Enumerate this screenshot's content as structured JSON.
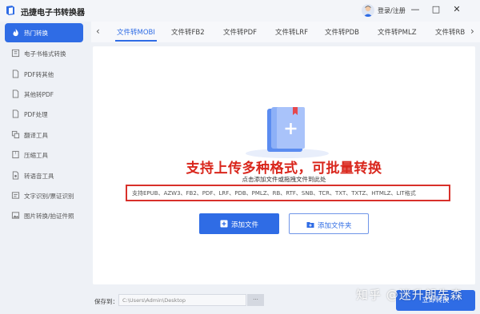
{
  "app": {
    "title": "迅捷电子书转换器",
    "brand_color": "#2f6ce5"
  },
  "header": {
    "login_label": "登录/注册",
    "min_icon": "—",
    "max_icon": "□",
    "close_icon": "✕"
  },
  "sidebar": {
    "items": [
      {
        "label": "热门转换",
        "active": true,
        "icon": "flame-icon"
      },
      {
        "label": "电子书格式转换",
        "icon": "book-icon"
      },
      {
        "label": "PDF转其他",
        "icon": "document-icon"
      },
      {
        "label": "其他转PDF",
        "icon": "document-icon"
      },
      {
        "label": "PDF处理",
        "icon": "document-icon"
      },
      {
        "label": "翻译工具",
        "icon": "translate-icon"
      },
      {
        "label": "压缩工具",
        "icon": "compress-icon"
      },
      {
        "label": "转语音工具",
        "icon": "audio-icon"
      },
      {
        "label": "文字识别/票证识别",
        "icon": "ocr-icon"
      },
      {
        "label": "图片转换/拍证件照",
        "icon": "image-icon"
      }
    ]
  },
  "tabs": {
    "prev": "‹",
    "next": "›",
    "items": [
      "文件转MOBI",
      "文件转FB2",
      "文件转PDF",
      "文件转LRF",
      "文件转PDB",
      "文件转PMLZ",
      "文件转RB"
    ],
    "active_index": 0
  },
  "upload": {
    "headline": "支持上传多种格式，可批量转换",
    "subline": "点击添加文件或拖拽文件到此处",
    "formats": "支持EPUB、AZW3、FB2、PDF、LRF、PDB、PMLZ、RB、RTF、SNB、TCR、TXT、TXTZ、HTMLZ、LIT格式",
    "add_file": "添加文件",
    "add_folder": "添加文件夹"
  },
  "footer": {
    "save_label": "保存到：",
    "path_value": "C:\\Users\\Admin\\Desktop",
    "browse_label": "···",
    "convert_label": "立即转换",
    "watermark": "知乎 @迷升朗先森"
  }
}
